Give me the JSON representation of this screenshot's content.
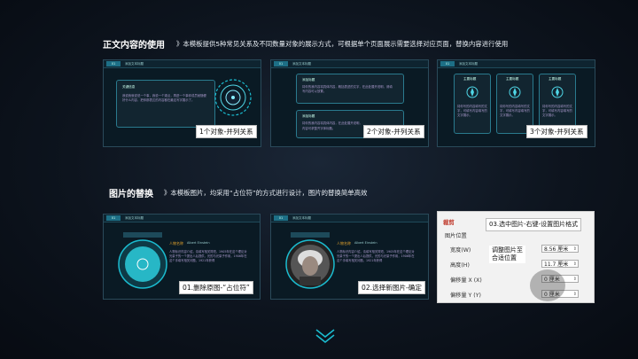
{
  "section1": {
    "title": "正文内容的使用",
    "desc": "》本模板提供5种常见关系及不同数量对象的展示方式，可根据单个页面展示需要选择对应页面，替换内容进行使用"
  },
  "section2": {
    "title": "图片的替换",
    "desc": "》本模板图片，均采用“占位符”的方式进行设计，图片的替换简单高效"
  },
  "thumbs_row1": [
    {
      "tag": "01",
      "header": "添加文本标题",
      "panel_title": "关键信息",
      "panel_body": "我说我就说说一个事，我说一个观点，再进一个事你成员就随便好什么内容，把你那表达的内容都在最这写字展示了。",
      "label": "1个对象-并列关系"
    },
    {
      "tag": "01",
      "header": "添加文本标题",
      "panel_title": "添加标题",
      "panel_body": "将你的我内容将具体内容，概括表述的文字，在此处展开说明，请填写内容可以放置。",
      "panel2_title": "添加标题",
      "panel2_body": "将你的我内容将具体内容，在此处展开说明，",
      "panel2_highlight": "内容可求整齐字体标题。",
      "label": "2个对象-并列关系"
    },
    {
      "tag": "01",
      "header": "添加文本标题",
      "card_titles": [
        "主要标题",
        "主要标题",
        "主要标题"
      ],
      "card_body": "将你写的内容填写的文字，可填写内容填写的文字展示。",
      "label": "3个对象-并列关系"
    }
  ],
  "thumbs_row2": [
    {
      "tag": "01",
      "header": "添加文本标题",
      "name": "人物名称",
      "sub": "Albert Einstein",
      "body": "人物标识内容介绍，请填写相关简短，1905年在这个理论对光量子的一个提出人后提供，光的与光量子作用，1906年在这个手填写相关问题，1921年获得",
      "label": "01.删除原图-“占位符”"
    },
    {
      "tag": "01",
      "header": "添加文本标题",
      "name": "人物名称",
      "sub": "Albert Einstein",
      "body": "人物标识内容介绍，请填写相关简短，1905年在这个理论对光量子的一个提出人后提供，光的与光量子作用，1906年在这个手填写相关问题，1921年获得",
      "label": "02.选择新图片-确定"
    }
  ],
  "ppt_panel": {
    "section": "裁剪",
    "subsection": "图片位置",
    "rows": [
      {
        "label": "宽度(W)",
        "value": "8.56 厘米"
      },
      {
        "label": "高度(H)",
        "value": "11.7 厘米"
      },
      {
        "label": "偏移量 X (X)",
        "value": "0 厘米"
      },
      {
        "label": "偏移量 Y (Y)",
        "value": "0 厘米"
      }
    ],
    "tip_top": "03.选中图片-右键-设置图片格式",
    "tip_mid": "调整图片至\n合适位置"
  },
  "colors": {
    "accent": "#1bbcd0",
    "highlight": "#e4a32c",
    "ppt_red": "#c0392b"
  }
}
